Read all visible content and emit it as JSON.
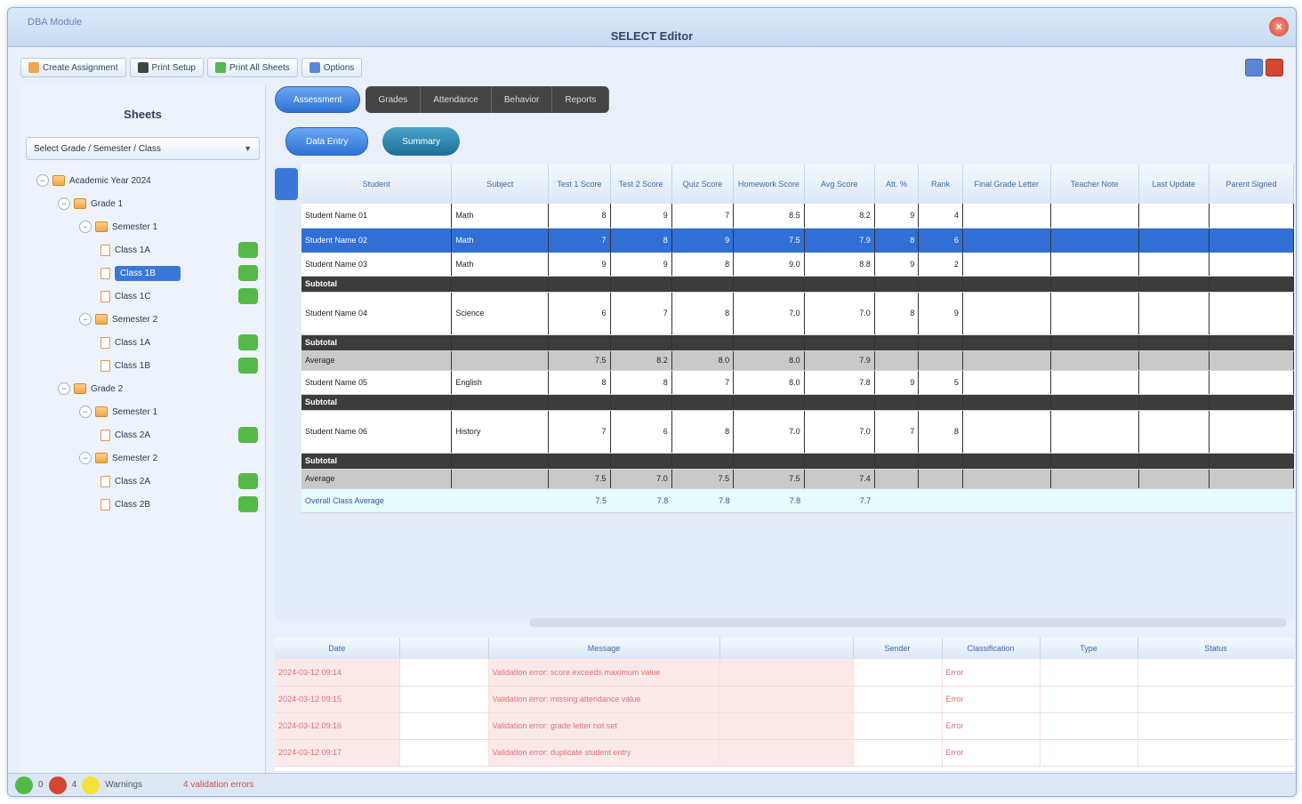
{
  "window": {
    "app_label": "DBA Module",
    "title": "SELECT Editor",
    "close_label": "×"
  },
  "toolbar": {
    "buttons": [
      {
        "label": "Create Assignment",
        "icon_color": "#f0a64a"
      },
      {
        "label": "Print Setup",
        "icon_color": "#444444"
      },
      {
        "label": "Print All Sheets",
        "icon_color": "#54b948"
      },
      {
        "label": "Options",
        "icon_color": "#5a86d4"
      }
    ]
  },
  "left_panel": {
    "title": "Sheets",
    "select_value": "Select Grade / Semester / Class",
    "tree": [
      {
        "label": "Academic Year 2024",
        "level": 0,
        "kind": "folder",
        "exp": "−"
      },
      {
        "label": "Grade 1",
        "level": 1,
        "kind": "folder",
        "exp": "−"
      },
      {
        "label": "Semester 1",
        "level": 2,
        "kind": "folder",
        "exp": "−"
      },
      {
        "label": "Class 1A",
        "level": 3,
        "kind": "doc",
        "badge": true
      },
      {
        "label": "Class 1B",
        "level": 3,
        "kind": "doc",
        "badge": true,
        "selected": true
      },
      {
        "label": "Class 1C",
        "level": 3,
        "kind": "doc",
        "badge": true
      },
      {
        "label": "Semester 2",
        "level": 2,
        "kind": "folder",
        "exp": "−"
      },
      {
        "label": "Class 1A",
        "level": 3,
        "kind": "doc",
        "badge": true
      },
      {
        "label": "Class 1B",
        "level": 3,
        "kind": "doc",
        "badge": true
      },
      {
        "label": "Grade 2",
        "level": 1,
        "kind": "folder",
        "exp": "−"
      },
      {
        "label": "Semester 1",
        "level": 2,
        "kind": "folder",
        "exp": "−"
      },
      {
        "label": "Class 2A",
        "level": 3,
        "kind": "doc",
        "badge": true
      },
      {
        "label": "Semester 2",
        "level": 2,
        "kind": "folder",
        "exp": "−"
      },
      {
        "label": "Class 2A",
        "level": 3,
        "kind": "doc",
        "badge": true
      },
      {
        "label": "Class 2B",
        "level": 3,
        "kind": "doc",
        "badge": true
      }
    ]
  },
  "tabs": {
    "primary": "Assessment",
    "dark": [
      "Grades",
      "Attendance",
      "Behavior",
      "Reports"
    ],
    "secondary": [
      "Data Entry",
      "Summary"
    ]
  },
  "grid": {
    "headers": [
      "Student",
      "Subject",
      "Test 1 Score",
      "Test 2 Score",
      "Quiz Score",
      "Homework Score",
      "Avg Score",
      "Att. %",
      "Rank",
      "Final Grade Letter",
      "Teacher Note",
      "Last Update",
      "Parent Signed"
    ],
    "rows": [
      {
        "type": "normal",
        "cells": [
          "Student Name 01",
          "Math",
          "8",
          "9",
          "7",
          "8.5",
          "8.2",
          "9",
          "4",
          "",
          "",
          "",
          ""
        ]
      },
      {
        "type": "hl",
        "cells": [
          "Student Name 02",
          "Math",
          "7",
          "8",
          "9",
          "7.5",
          "7.9",
          "8",
          "6",
          "",
          "",
          "",
          ""
        ]
      },
      {
        "type": "normal",
        "cells": [
          "Student Name 03",
          "Math",
          "9",
          "9",
          "8",
          "9.0",
          "8.8",
          "9",
          "2",
          "",
          "",
          "",
          ""
        ]
      },
      {
        "type": "sec",
        "cells": [
          "Subtotal",
          "",
          "",
          "",
          "",
          "",
          "",
          "",
          "",
          "",
          "",
          "",
          ""
        ]
      },
      {
        "type": "tall",
        "cells": [
          "Student Name 04",
          "Science",
          "6",
          "7",
          "8",
          "7.0",
          "7.0",
          "8",
          "9",
          "",
          "",
          "",
          ""
        ]
      },
      {
        "type": "sec",
        "cells": [
          "Subtotal",
          "",
          "",
          "",
          "",
          "",
          "",
          "",
          "",
          "",
          "",
          "",
          ""
        ]
      },
      {
        "type": "tot",
        "cells": [
          "Average",
          "",
          "7.5",
          "8.2",
          "8.0",
          "8.0",
          "7.9",
          "",
          "",
          "",
          "",
          "",
          ""
        ]
      },
      {
        "type": "normal",
        "cells": [
          "Student Name 05",
          "English",
          "8",
          "8",
          "7",
          "8.0",
          "7.8",
          "9",
          "5",
          "",
          "",
          "",
          ""
        ]
      },
      {
        "type": "sec",
        "cells": [
          "Subtotal",
          "",
          "",
          "",
          "",
          "",
          "",
          "",
          "",
          "",
          "",
          "",
          ""
        ]
      },
      {
        "type": "tall",
        "cells": [
          "Student Name 06",
          "History",
          "7",
          "6",
          "8",
          "7.0",
          "7.0",
          "7",
          "8",
          "",
          "",
          "",
          ""
        ]
      },
      {
        "type": "sec",
        "cells": [
          "Subtotal",
          "",
          "",
          "",
          "",
          "",
          "",
          "",
          "",
          "",
          "",
          "",
          ""
        ]
      },
      {
        "type": "tot",
        "cells": [
          "Average",
          "",
          "7.5",
          "7.0",
          "7.5",
          "7.5",
          "7.4",
          "",
          "",
          "",
          "",
          "",
          ""
        ]
      },
      {
        "type": "grand",
        "cells": [
          "Overall Class Average",
          "",
          "7.5",
          "7.8",
          "7.8",
          "7.8",
          "7.7",
          "",
          "",
          "",
          "",
          "",
          ""
        ]
      }
    ]
  },
  "log": {
    "headers": [
      "Date",
      "",
      "Message",
      "",
      "Sender",
      "Classification",
      "Type",
      "Status"
    ],
    "rows": [
      [
        "2024-03-12 09:14",
        "",
        "Validation error: score exceeds maximum value",
        "",
        "",
        "Error",
        "",
        ""
      ],
      [
        "2024-03-12 09:15",
        "",
        "Validation error: missing attendance value",
        "",
        "",
        "Error",
        "",
        ""
      ],
      [
        "2024-03-12 09:16",
        "",
        "Validation error: grade letter not set",
        "",
        "",
        "Error",
        "",
        ""
      ],
      [
        "2024-03-12 09:17",
        "",
        "Validation error: duplicate student entry",
        "",
        "",
        "Error",
        "",
        ""
      ]
    ]
  },
  "status": {
    "ok_count": "0",
    "error_count": "4",
    "warning_label": "Warnings",
    "error_text": "4 validation errors"
  }
}
